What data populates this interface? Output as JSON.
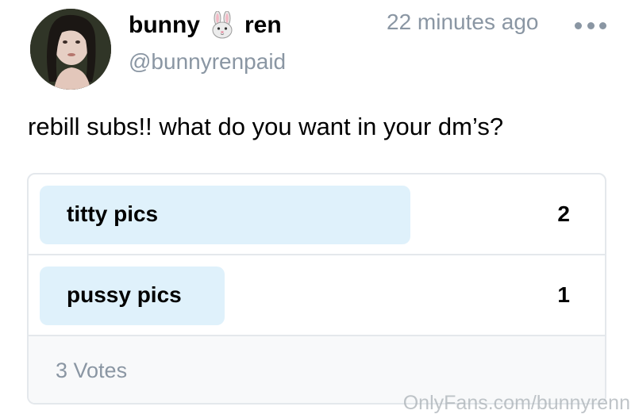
{
  "post": {
    "display_name_first": "bunny",
    "display_name_emoji": "rabbit-face-icon",
    "display_name_last": "ren",
    "handle": "@bunnyrenpaid",
    "time": "22 minutes ago",
    "more_icon": "more-dots-icon",
    "text": "rebill subs!! what do you want in your dm’s?"
  },
  "poll": {
    "options": [
      {
        "label": "titty pics",
        "count": "2",
        "fraction": 0.6667
      },
      {
        "label": "pussy pics",
        "count": "1",
        "fraction": 0.3333
      }
    ],
    "total_votes": "3 Votes",
    "bar_color": "#dff1fb"
  },
  "watermark": "OnlyFans.com/bunnyrenn",
  "colors": {
    "muted_text": "#8a96a3",
    "border": "#e4e8ec"
  }
}
